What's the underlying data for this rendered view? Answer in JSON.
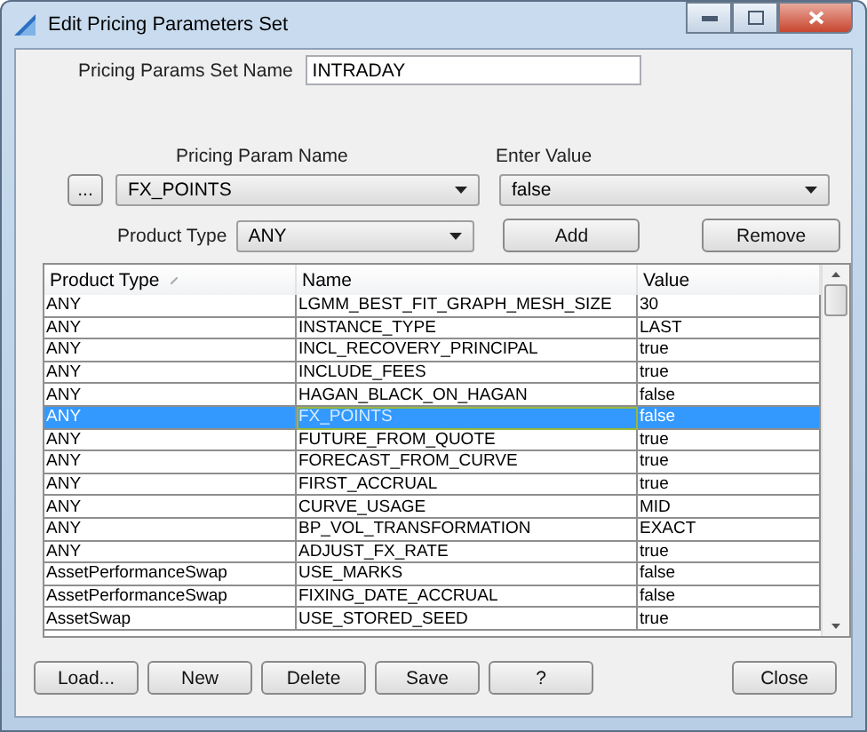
{
  "window": {
    "title": "Edit Pricing Parameters Set"
  },
  "set_name": {
    "label": "Pricing Params Set Name",
    "value": "INTRADAY"
  },
  "param_name": {
    "label": "Pricing Param Name",
    "browse": "...",
    "value": "FX_POINTS"
  },
  "enter_value": {
    "label": "Enter Value",
    "value": "false"
  },
  "product_type": {
    "label": "Product Type",
    "value": "ANY"
  },
  "actions": [
    "Add",
    "Remove"
  ],
  "table": {
    "columns": [
      "Product Type",
      "Name",
      "Value"
    ],
    "rows": [
      {
        "cells": [
          "ANY",
          "LGMM_BEST_FIT_GRAPH_MESH_SIZE",
          "30"
        ],
        "selected": false
      },
      {
        "cells": [
          "ANY",
          "INSTANCE_TYPE",
          "LAST"
        ],
        "selected": false
      },
      {
        "cells": [
          "ANY",
          "INCL_RECOVERY_PRINCIPAL",
          "true"
        ],
        "selected": false
      },
      {
        "cells": [
          "ANY",
          "INCLUDE_FEES",
          "true"
        ],
        "selected": false
      },
      {
        "cells": [
          "ANY",
          "HAGAN_BLACK_ON_HAGAN",
          "false"
        ],
        "selected": false
      },
      {
        "cells": [
          "ANY",
          "FX_POINTS",
          "false"
        ],
        "selected": true
      },
      {
        "cells": [
          "ANY",
          "FUTURE_FROM_QUOTE",
          "true"
        ],
        "selected": false
      },
      {
        "cells": [
          "ANY",
          "FORECAST_FROM_CURVE",
          "true"
        ],
        "selected": false
      },
      {
        "cells": [
          "ANY",
          "FIRST_ACCRUAL",
          "true"
        ],
        "selected": false
      },
      {
        "cells": [
          "ANY",
          "CURVE_USAGE",
          "MID"
        ],
        "selected": false
      },
      {
        "cells": [
          "ANY",
          "BP_VOL_TRANSFORMATION",
          "EXACT"
        ],
        "selected": false
      },
      {
        "cells": [
          "ANY",
          "ADJUST_FX_RATE",
          "true"
        ],
        "selected": false
      },
      {
        "cells": [
          "AssetPerformanceSwap",
          "USE_MARKS",
          "false"
        ],
        "selected": false
      },
      {
        "cells": [
          "AssetPerformanceSwap",
          "FIXING_DATE_ACCRUAL",
          "false"
        ],
        "selected": false
      },
      {
        "cells": [
          "AssetSwap",
          "USE_STORED_SEED",
          "true"
        ],
        "selected": false
      }
    ]
  },
  "buttons": [
    "Load...",
    "New",
    "Delete",
    "Save",
    "?"
  ],
  "close": "Close"
}
